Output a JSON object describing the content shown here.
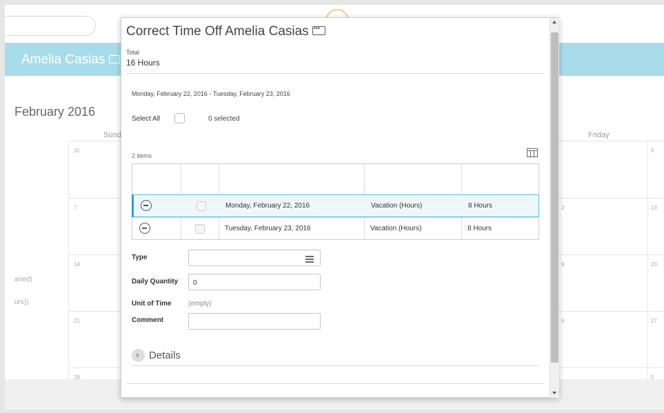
{
  "background": {
    "worker_name": "Amelia Casias",
    "month_title": "February 2016",
    "day_headers": [
      "Sund",
      "Friday"
    ],
    "week_numbers": [
      "31",
      "7",
      "14",
      "21",
      "28"
    ],
    "right_numbers": [
      "6",
      "13",
      "20",
      "27",
      "5"
    ],
    "friday_numbers": [
      "2",
      "9",
      "6"
    ],
    "side_labels": [
      "aried)",
      "urs))"
    ]
  },
  "modal": {
    "title": "Correct Time Off  Amelia Casias",
    "total_label": "Total",
    "total_value": "16 Hours",
    "date_range": "Monday, February 22, 2016 - Tuesday, February 23, 2016",
    "select_all_label": "Select All",
    "selected_count": "0 selected",
    "items_count": "2 items",
    "rows": [
      {
        "date": "Monday, February 22, 2016",
        "type": "Vacation (Hours)",
        "quantity": "8 Hours"
      },
      {
        "date": "Tuesday, February 23, 2016",
        "type": "Vacation (Hours)",
        "quantity": "8 Hours"
      }
    ],
    "form": {
      "type_label": "Type",
      "type_value": "",
      "daily_quantity_label": "Daily Quantity",
      "daily_quantity_value": "0",
      "unit_of_time_label": "Unit of Time",
      "unit_of_time_value": "(empty)",
      "comment_label": "Comment",
      "comment_value": ""
    },
    "details_label": "Details"
  },
  "colors": {
    "header_bar": "#a8dcea",
    "selected_row_border": "#2b9fd8"
  }
}
